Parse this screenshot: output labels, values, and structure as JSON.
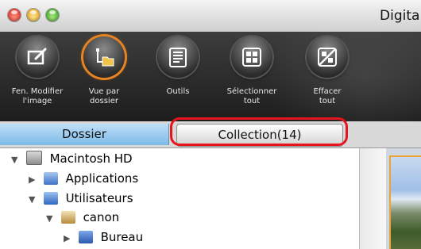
{
  "window": {
    "title": "Digita"
  },
  "toolbar": {
    "tools": [
      {
        "label_line1": "Fen. Modifier",
        "label_line2": "l'image",
        "icon": "edit-image-icon"
      },
      {
        "label_line1": "Vue par",
        "label_line2": "dossier",
        "icon": "folder-view-icon"
      },
      {
        "label_line1": "Outils",
        "label_line2": "",
        "icon": "tools-icon"
      },
      {
        "label_line1": "Sélectionner",
        "label_line2": "tout",
        "icon": "select-all-icon"
      },
      {
        "label_line1": "Effacer",
        "label_line2": "tout",
        "icon": "clear-all-icon"
      }
    ]
  },
  "tabs": {
    "dossier": "Dossier",
    "collection": "Collection(14)"
  },
  "tree": {
    "items": [
      {
        "label": "Macintosh HD",
        "icon": "hard-drive-icon"
      },
      {
        "label": "Applications",
        "icon": "applications-folder-icon"
      },
      {
        "label": "Utilisateurs",
        "icon": "users-folder-icon"
      },
      {
        "label": "canon",
        "icon": "home-icon"
      },
      {
        "label": "Bureau",
        "icon": "desktop-folder-icon"
      }
    ]
  },
  "colors": {
    "highlight": "#e6141c",
    "active_tool_ring": "#e8841f",
    "dossier_tab": "#7db9e8"
  }
}
